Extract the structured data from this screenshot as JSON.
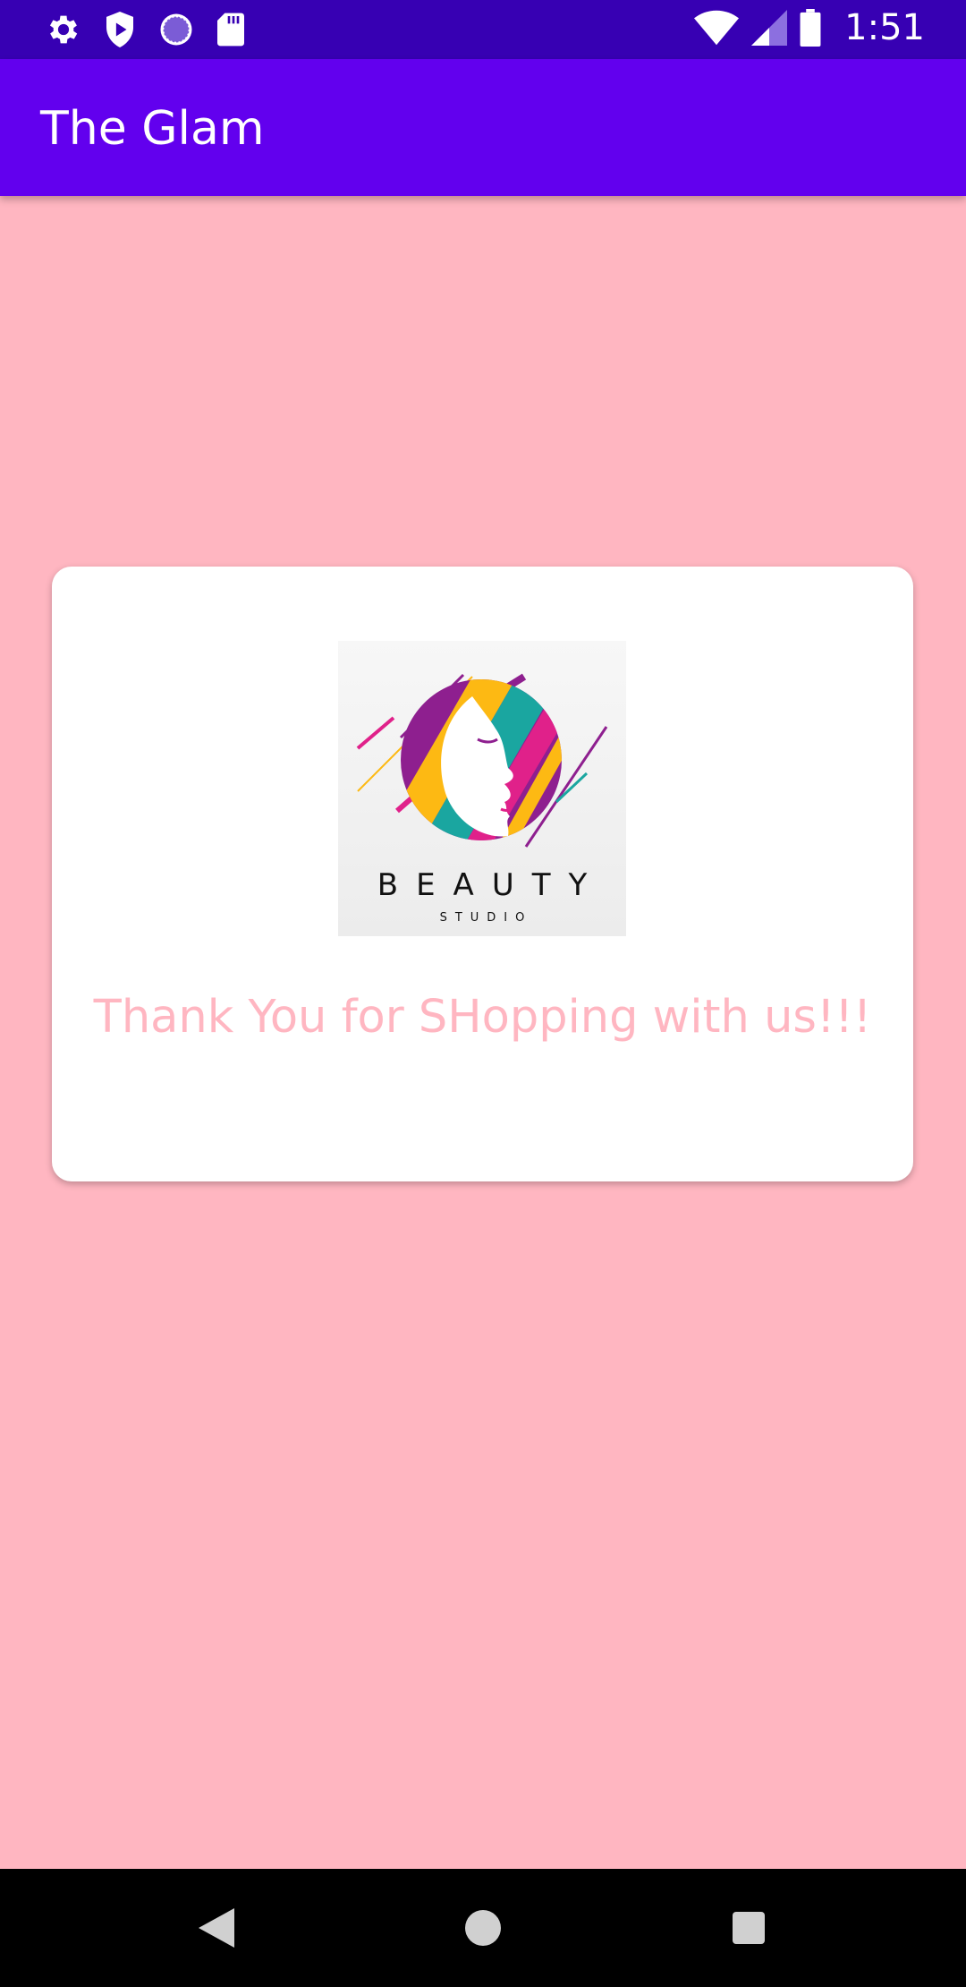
{
  "status_bar": {
    "time": "1:51",
    "left_icons": [
      "gear-icon",
      "shield-play-icon",
      "loading-circle-icon",
      "sd-card-icon"
    ],
    "right_icons": [
      "wifi-icon",
      "cell-signal-icon",
      "battery-icon"
    ]
  },
  "app_bar": {
    "title": "The Glam"
  },
  "card": {
    "logo": {
      "word": "BEAUTY",
      "sub": "STUDIO"
    },
    "message": "Thank You for SHopping with us!!!"
  },
  "nav_bar": {
    "icons": [
      "back-icon",
      "home-icon",
      "recents-icon"
    ]
  },
  "colors": {
    "status_bar": "#3700B3",
    "app_bar": "#6200EE",
    "background": "#FFB6C1",
    "message_text": "#FFB6C1",
    "card": "#FFFFFF",
    "nav_bar": "#000000"
  }
}
